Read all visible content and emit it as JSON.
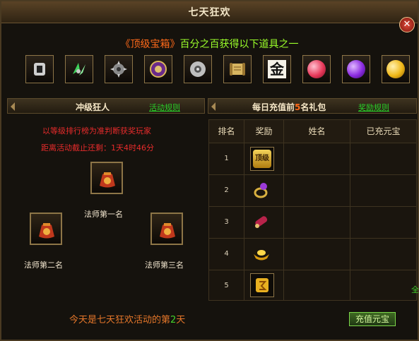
{
  "window": {
    "title": "七天狂欢"
  },
  "promo": {
    "box": "《顶级宝箱》",
    "text": "百分之百获得以下道具之一"
  },
  "items": [
    {
      "icon": "silver-ring-icon"
    },
    {
      "icon": "green-shards-icon"
    },
    {
      "icon": "spiked-gear-icon"
    },
    {
      "icon": "purple-seal-icon"
    },
    {
      "icon": "jade-disc-icon"
    },
    {
      "icon": "scroll-icon"
    },
    {
      "icon": "gold-token-icon",
      "glyph": "金"
    },
    {
      "icon": "red-gem-icon",
      "color": "#e8395a"
    },
    {
      "icon": "purple-gem-icon",
      "color": "#8b2be0"
    },
    {
      "icon": "gold-gem-icon",
      "color": "#f0b818"
    }
  ],
  "left": {
    "header": "冲级狂人",
    "rules": "活动规则",
    "notice1": "以等级排行榜为准判断获奖玩家",
    "notice2": "距离活动截止还剩：1天4时46分",
    "first": "法师第一名",
    "second": "法师第二名",
    "third": "法师第三名"
  },
  "right": {
    "header_prefix": "每日充值前",
    "header_count": "5",
    "header_suffix": "名礼包",
    "rules": "奖励规则",
    "columns": [
      "排名",
      "奖励",
      "姓名",
      "已充元宝"
    ],
    "rows": [
      {
        "rank": "1",
        "icon": "top-box-icon",
        "label": "顶级"
      },
      {
        "rank": "2",
        "icon": "amethyst-ring-icon"
      },
      {
        "rank": "3",
        "icon": "red-scroll-icon"
      },
      {
        "rank": "4",
        "icon": "gold-ingot-icon"
      },
      {
        "rank": "5",
        "icon": "gold-talisman-icon"
      }
    ]
  },
  "footer": {
    "prefix": "今天是七天狂欢活动的第",
    "day": "2",
    "suffix": "天"
  },
  "recharge": "充值元宝",
  "side_char": "全"
}
